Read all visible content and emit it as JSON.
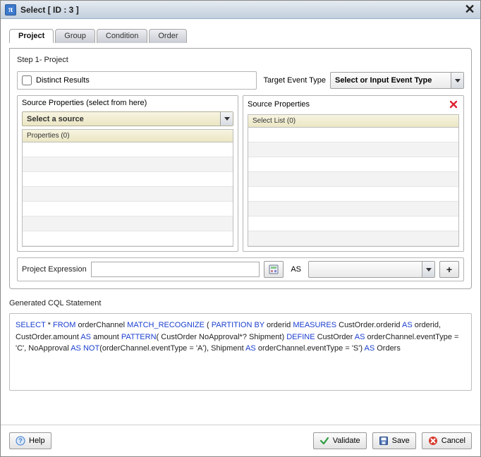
{
  "dialog": {
    "title": "Select [ ID : 3 ]"
  },
  "tabs": [
    {
      "label": "Project",
      "active": true
    },
    {
      "label": "Group",
      "active": false
    },
    {
      "label": "Condition",
      "active": false
    },
    {
      "label": "Order",
      "active": false
    }
  ],
  "step": {
    "label": "Step 1- Project"
  },
  "distinct": {
    "label": "Distinct Results"
  },
  "target": {
    "label": "Target Event Type",
    "value": "Select or Input Event Type"
  },
  "sourceLeft": {
    "title": "Source Properties (select from here)",
    "sourceSelect": "Select a source",
    "columnHead": "Properties (0)"
  },
  "sourceRight": {
    "title": "Source Properties",
    "columnHead": "Select List (0)"
  },
  "expr": {
    "label": "Project Expression",
    "asLabel": "AS",
    "aliasValue": ""
  },
  "generated": {
    "label": "Generated CQL Statement",
    "tokens": [
      {
        "t": "SELECT",
        "k": true
      },
      {
        "t": " * "
      },
      {
        "t": "FROM",
        "k": true
      },
      {
        "t": " orderChannel  "
      },
      {
        "t": "MATCH_RECOGNIZE",
        "k": true
      },
      {
        "t": " ( "
      },
      {
        "t": "PARTITION BY",
        "k": true
      },
      {
        "t": " orderid "
      },
      {
        "t": "MEASURES",
        "k": true
      },
      {
        "t": " CustOrder.orderid "
      },
      {
        "t": "AS",
        "k": true
      },
      {
        "t": " orderid, CustOrder.amount "
      },
      {
        "t": "AS",
        "k": true
      },
      {
        "t": " amount "
      },
      {
        "t": "PATTERN",
        "k": true
      },
      {
        "t": "( CustOrder NoApproval*? Shipment) "
      },
      {
        "t": "DEFINE",
        "k": true
      },
      {
        "t": " CustOrder "
      },
      {
        "t": "AS",
        "k": true
      },
      {
        "t": " orderChannel.eventType = 'C', NoApproval "
      },
      {
        "t": "AS",
        "k": true
      },
      {
        "t": " "
      },
      {
        "t": "NOT",
        "k": true
      },
      {
        "t": "(orderChannel.eventType = 'A'), Shipment "
      },
      {
        "t": "AS",
        "k": true
      },
      {
        "t": " orderChannel.eventType = 'S') "
      },
      {
        "t": "AS",
        "k": true
      },
      {
        "t": " Orders"
      }
    ]
  },
  "footer": {
    "help": "Help",
    "validate": "Validate",
    "save": "Save",
    "cancel": "Cancel"
  }
}
